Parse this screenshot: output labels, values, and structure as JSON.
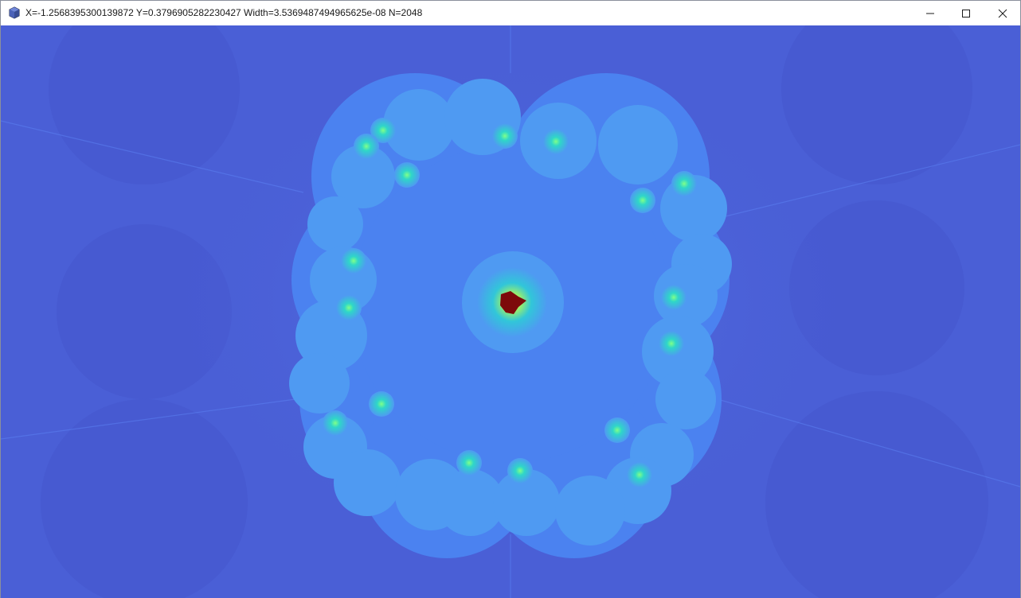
{
  "window": {
    "title": "X=-1.2568395300139872 Y=0.3796905282230427 Width=3.5369487494965625e-08 N=2048",
    "app_icon": "cube-icon"
  },
  "controls": {
    "minimize": "minimize-icon",
    "maximize": "maximize-icon",
    "close": "close-icon"
  },
  "fractal": {
    "type": "mandelbrot",
    "colors": {
      "background": "#4a5fd6",
      "outer_glow": "#4e6ee4",
      "body": "#4b82f0",
      "bulb": "#4f9af2",
      "spiral_core": "#2fd6c8",
      "spiral_center": "#7fff8a",
      "heart_ring": "#31c6d9",
      "heart_glow": "#9bf06a",
      "heart_yellow": "#ffd21e",
      "set_core": "#7d0a0a"
    }
  }
}
